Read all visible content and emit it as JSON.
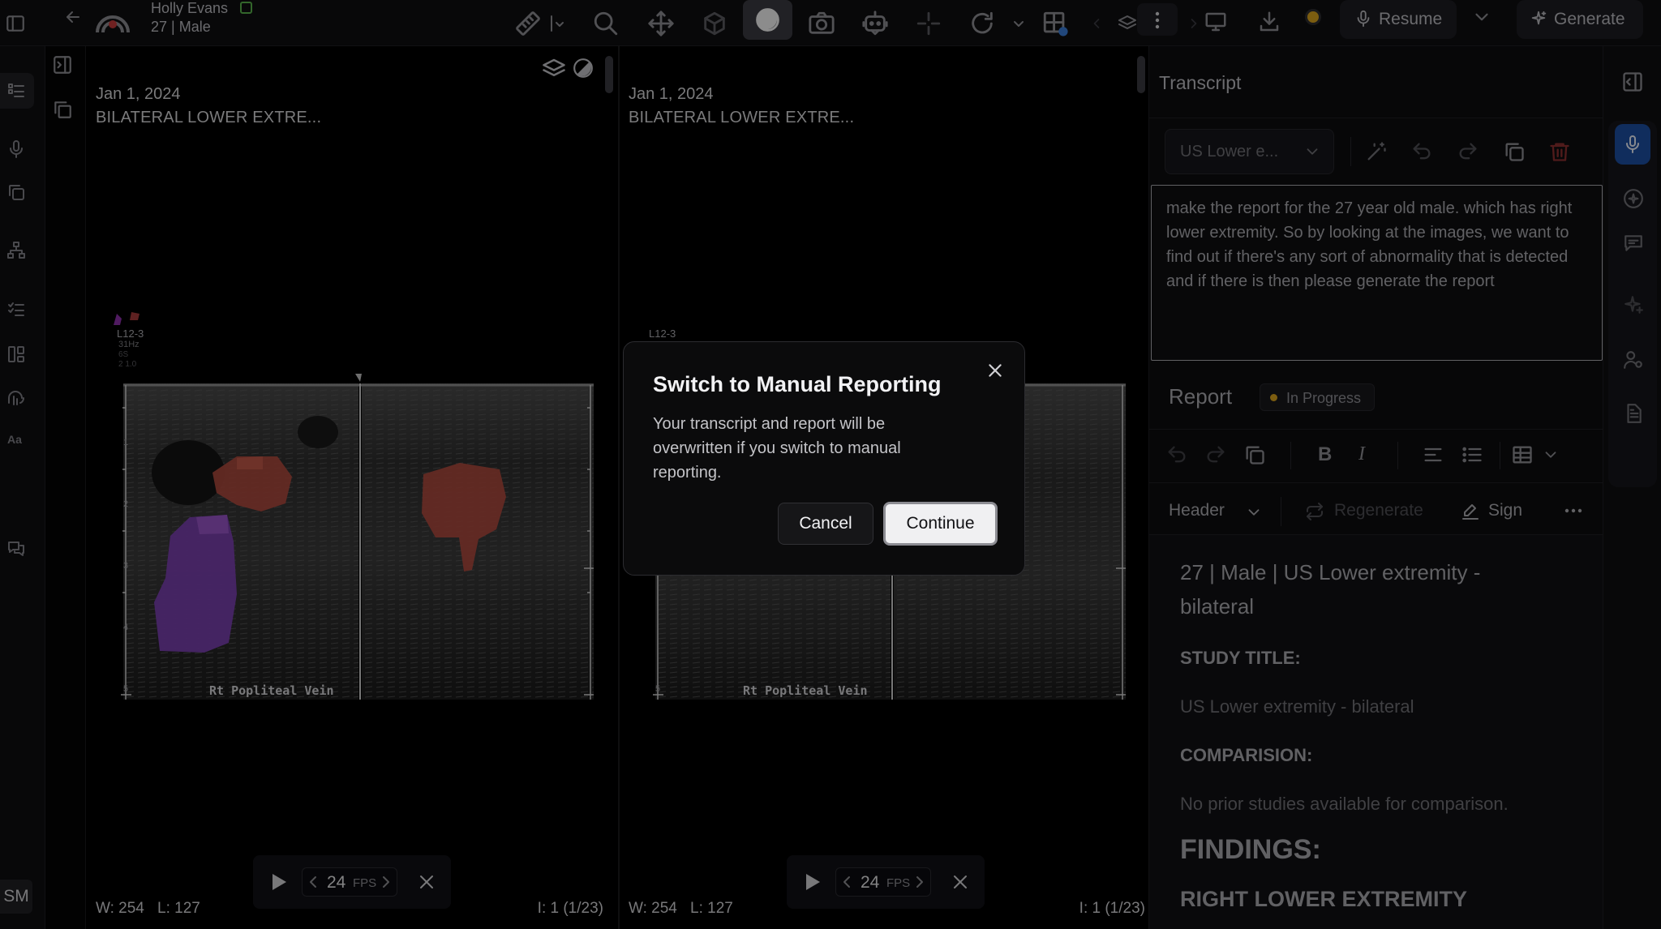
{
  "patient": {
    "name": "Holly Evans",
    "info": "27 | Male"
  },
  "toolbar": {
    "resume_label": "Resume",
    "generate_label": "Generate",
    "status_dot_color": "#d6a11c"
  },
  "viewports": [
    {
      "date": "Jan 1, 2024",
      "title": "BILATERAL LOWER EXTRE...",
      "scan_label": "Rt Popliteal Vein",
      "probe_label": "L12-3",
      "scan_params": [
        "31Hz",
        "6S",
        "2 1.0"
      ],
      "depth_ticks": [
        "1",
        "2",
        "3",
        "4",
        "5"
      ],
      "fps": "24",
      "fps_unit": "FPS",
      "window": "W: 254",
      "level": "L: 127",
      "frame_index": "I: 1 (1/23)"
    },
    {
      "date": "Jan 1, 2024",
      "title": "BILATERAL LOWER EXTRE...",
      "scan_label": "Rt Popliteal Vein",
      "probe_label": "L12-3",
      "depth_ticks": [
        "5"
      ],
      "fps": "24",
      "fps_unit": "FPS",
      "window": "W: 254",
      "level": "L: 127",
      "frame_index": "I: 1 (1/23)"
    }
  ],
  "transcript": {
    "heading": "Transcript",
    "template_select": "US Lower e...",
    "text": "make the report for the 27 year old male. which has right lower extremity. So by looking at the images, we want to find out if there's any sort of abnormality that is detected and if there is then please generate the report"
  },
  "report": {
    "heading": "Report",
    "status": "In Progress",
    "status_color": "#d6a11c",
    "header_select": "Header",
    "regenerate_label": "Regenerate",
    "sign_label": "Sign",
    "doc_title": "27 | Male | US Lower extremity - bilateral",
    "study_title_label": "STUDY TITLE:",
    "study_title_value": "US Lower extremity - bilateral",
    "comparison_label": "COMPARISION:",
    "comparison_value": "No prior studies available for comparison.",
    "findings_label": "FINDINGS:",
    "findings_sub": "RIGHT LOWER EXTREMITY"
  },
  "user_initials": "SM",
  "modal": {
    "title": "Switch to Manual Reporting",
    "body": "Your transcript and report will be overwritten if you switch to manual reporting.",
    "cancel_label": "Cancel",
    "continue_label": "Continue"
  },
  "icons": {
    "left_rail": [
      "sidebar-toggle-icon",
      "worklist-icon",
      "microphone-icon",
      "copy-icon",
      "hierarchy-icon",
      "checklist-icon",
      "layout-icon",
      "voice-icon",
      "text-size-icon",
      "chat-icon"
    ],
    "toolbar": [
      "back-arrow-icon",
      "logo-icon",
      "ruler-icon",
      "zoom-icon",
      "pan-icon",
      "rotate-3d-icon",
      "contrast-icon",
      "camera-icon",
      "ai-bot-icon",
      "crosshair-icon",
      "redo-icon",
      "layout-grid-icon",
      "more-icon",
      "monitor-icon",
      "download-icon"
    ],
    "right_rail": [
      "panel-collapse-icon",
      "microphone-icon",
      "sparkle-circle-icon",
      "message-icon",
      "ai-star-icon",
      "user-settings-icon",
      "document-icon"
    ]
  }
}
